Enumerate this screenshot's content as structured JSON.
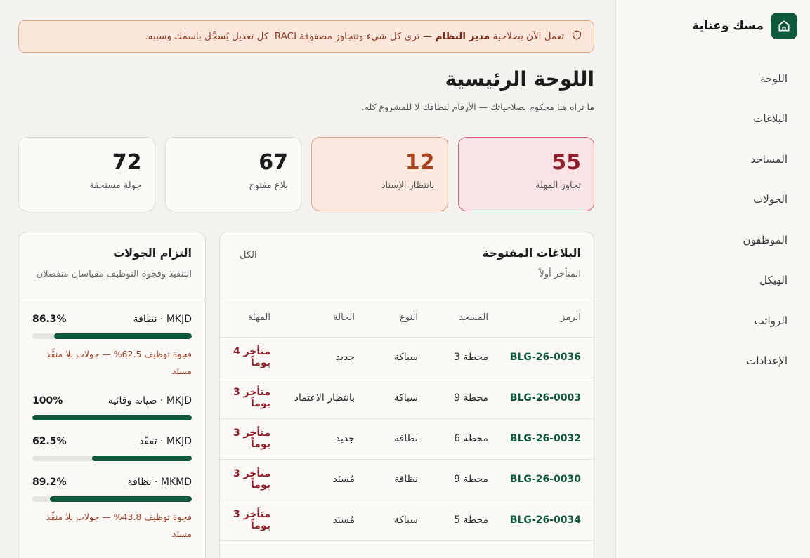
{
  "brand": {
    "name": "مسك وعناية",
    "logo_icon": "mosque-home-icon",
    "accent": "#0f5a3c"
  },
  "nav": [
    {
      "label": "اللوحة"
    },
    {
      "label": "البلاغات"
    },
    {
      "label": "المساجد"
    },
    {
      "label": "الجولات"
    },
    {
      "label": "الموظفون"
    },
    {
      "label": "الهيكل"
    },
    {
      "label": "الرواتب"
    },
    {
      "label": "الإعدادات"
    }
  ],
  "banner": {
    "icon": "shield-icon",
    "prefix": "تعمل الآن بصلاحية",
    "role": "مدير النظام",
    "suffix": "— ترى كل شيء وتتجاوز مصفوفة RACI. كل تعديل يُسجَّل باسمك وسببه."
  },
  "page": {
    "title": "اللوحة الرئيسية",
    "subtitle": "ما تراه هنا محكوم بصلاحياتك — الأرقام لنطاقك لا للمشروع كله."
  },
  "stats": [
    {
      "value": "55",
      "label": "تجاوز المهلة",
      "tone": "red"
    },
    {
      "value": "12",
      "label": "بانتظار الإسناد",
      "tone": "orange"
    },
    {
      "value": "67",
      "label": "بلاغ مفتوح",
      "tone": "plain"
    },
    {
      "value": "72",
      "label": "جولة مستحقة",
      "tone": "plain"
    }
  ],
  "tickets": {
    "title": "البلاغات المفتوحة",
    "subtitle": "المتأخر أولاً",
    "all_link": "الكل",
    "columns": [
      "الرمز",
      "المسجد",
      "النوع",
      "الحالة",
      "المهلة"
    ],
    "rows": [
      {
        "code": "BLG-26-0036",
        "mosque": "محطة 3",
        "type": "سباكة",
        "status": "جديد",
        "due": "متأخر 4 يوماً"
      },
      {
        "code": "BLG-26-0003",
        "mosque": "محطة 9",
        "type": "سباكة",
        "status": "بانتظار الاعتماد",
        "due": "متأخر 3 يوماً"
      },
      {
        "code": "BLG-26-0032",
        "mosque": "محطة 6",
        "type": "نظافة",
        "status": "جديد",
        "due": "متأخر 3 يوماً"
      },
      {
        "code": "BLG-26-0030",
        "mosque": "محطة 9",
        "type": "نظافة",
        "status": "مُسنَد",
        "due": "متأخر 3 يوماً"
      },
      {
        "code": "BLG-26-0034",
        "mosque": "محطة 5",
        "type": "سباكة",
        "status": "مُسنَد",
        "due": "متأخر 3 يوماً"
      }
    ]
  },
  "compliance": {
    "title": "التزام الجولات",
    "subtitle": "التنفيذ وفجوة التوظيف مقياسان منفصلان",
    "items": [
      {
        "label": "MKJD · نظافة",
        "pct": "86.3%",
        "value": 86.3,
        "gap": "فجوة توظيف 62.5% — جولات بلا منفِّذ مسنَد"
      },
      {
        "label": "MKJD · صيانة وقائية",
        "pct": "100%",
        "value": 100,
        "gap": ""
      },
      {
        "label": "MKJD · تفقّد",
        "pct": "62.5%",
        "value": 62.5,
        "gap": ""
      },
      {
        "label": "MKMD · نظافة",
        "pct": "89.2%",
        "value": 89.2,
        "gap": "فجوة توظيف 43.8% — جولات بلا منفِّذ مسنَد"
      }
    ]
  }
}
